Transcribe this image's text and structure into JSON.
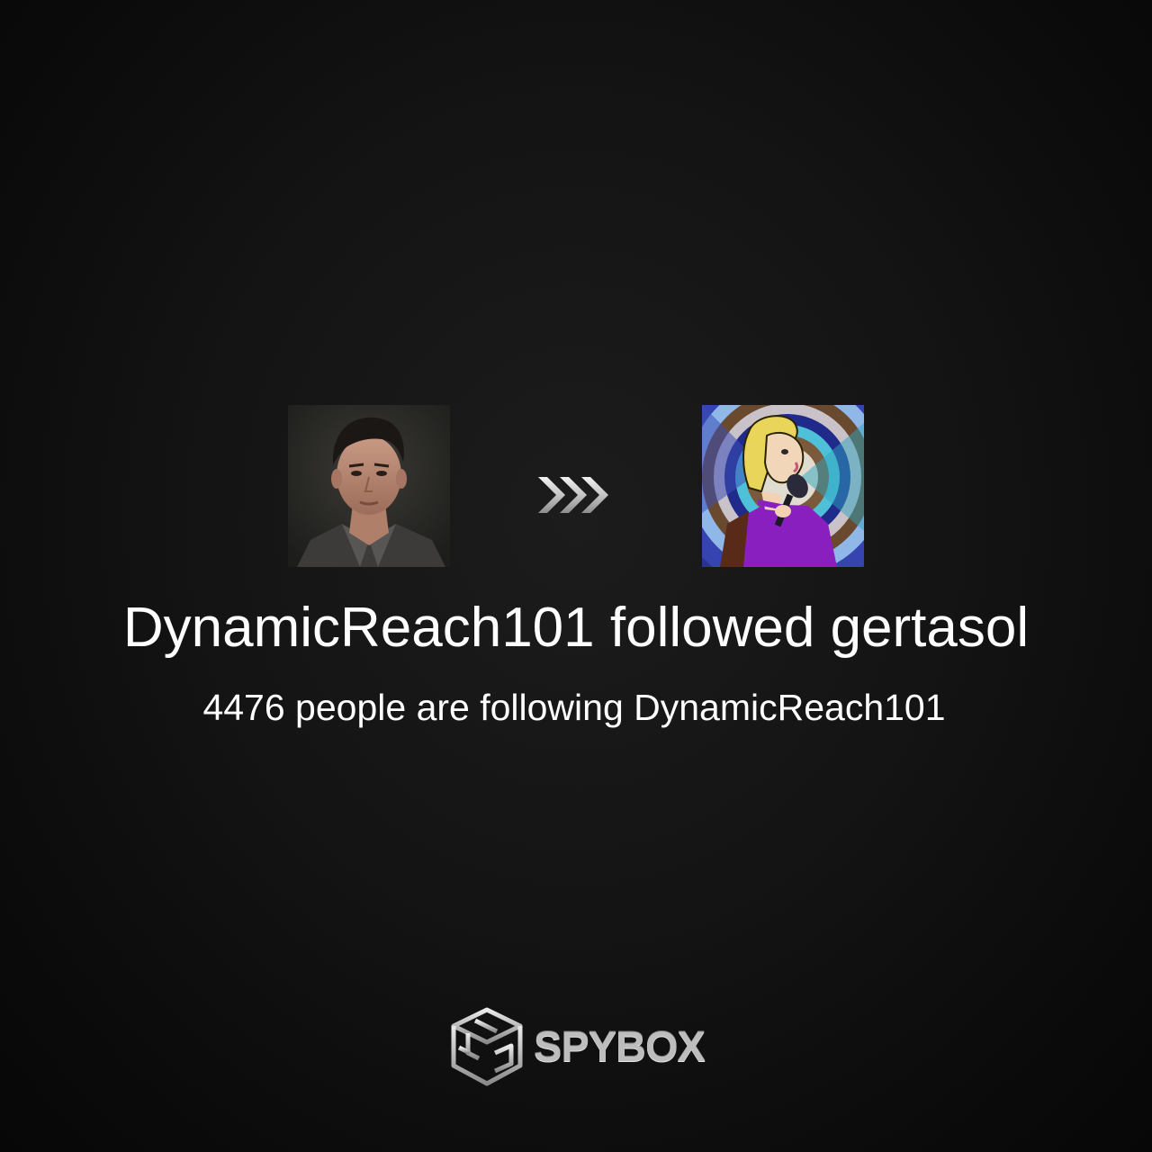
{
  "actor": {
    "username": "DynamicReach101",
    "avatar_icon": "person-portrait"
  },
  "target": {
    "username": "gertasol",
    "avatar_icon": "cartoon-singer-portrait"
  },
  "headline": "DynamicReach101 followed gertasol",
  "subline": "4476 people are following DynamicReach101",
  "arrow_icon": "triple-chevron-right-icon",
  "brand": {
    "name": "SPYBOX",
    "logo_icon": "spybox-cube-logo"
  },
  "colors": {
    "background": "#141414",
    "text": "#ffffff",
    "brand_text": "#bdbdbd",
    "target_outfit": "#8a1fc0"
  }
}
